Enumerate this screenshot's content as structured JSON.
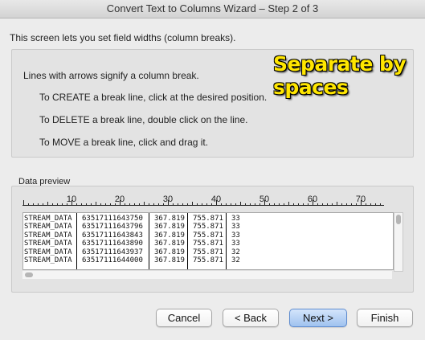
{
  "window": {
    "title": "Convert Text to Columns Wizard – Step 2 of 3"
  },
  "intro_text": "This screen lets you set field widths (column breaks).",
  "info": {
    "line1": "Lines with arrows signify a column break.",
    "line2": "To CREATE a break line, click at the desired position.",
    "line3": "To DELETE a break line, double click on the line.",
    "line4": "To MOVE a break line, click and drag it.",
    "annotation_line1": "Separate by",
    "annotation_line2": "spaces"
  },
  "preview": {
    "label": "Data preview",
    "ruler_numbers": [
      "10",
      "20",
      "30",
      "40",
      "50",
      "60",
      "70"
    ],
    "break_columns": [
      11,
      26,
      34,
      42
    ],
    "rows": [
      {
        "c1": "STREAM_DATA",
        "c2": "63517111643750",
        "c3": "367.819",
        "c4": "755.871",
        "c5": "33"
      },
      {
        "c1": "STREAM_DATA",
        "c2": "63517111643796",
        "c3": "367.819",
        "c4": "755.871",
        "c5": "33"
      },
      {
        "c1": "STREAM_DATA",
        "c2": "63517111643843",
        "c3": "367.819",
        "c4": "755.871",
        "c5": "33"
      },
      {
        "c1": "STREAM_DATA",
        "c2": "63517111643890",
        "c3": "367.819",
        "c4": "755.871",
        "c5": "33"
      },
      {
        "c1": "STREAM_DATA",
        "c2": "63517111643937",
        "c3": "367.819",
        "c4": "755.871",
        "c5": "32"
      },
      {
        "c1": "STREAM_DATA",
        "c2": "63517111644000",
        "c3": "367.819",
        "c4": "755.871",
        "c5": "32"
      }
    ]
  },
  "buttons": {
    "cancel": "Cancel",
    "back": "< Back",
    "next": "Next >",
    "finish": "Finish"
  },
  "colors": {
    "annotation": "#ffe600",
    "primary_button": "#9fc2ef"
  }
}
